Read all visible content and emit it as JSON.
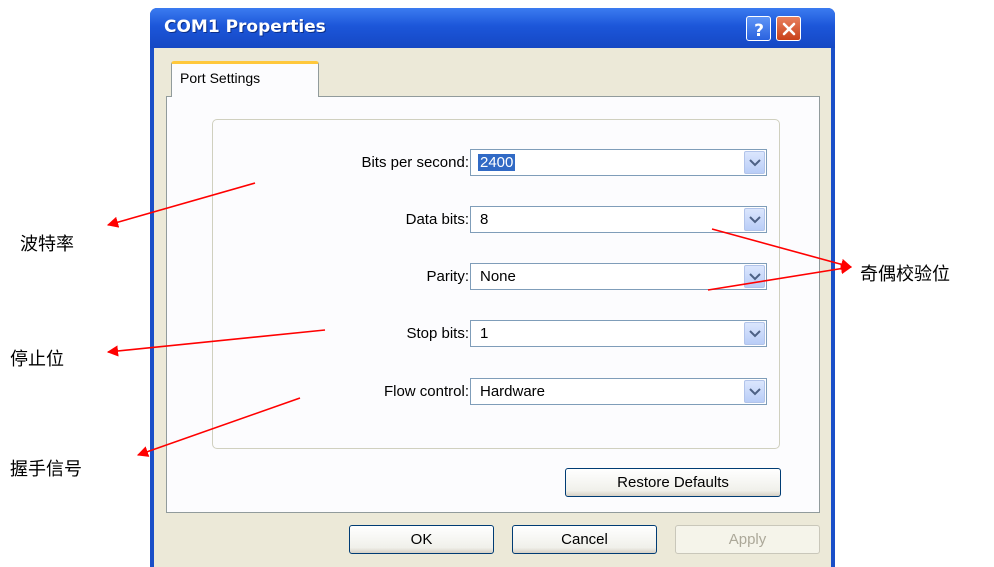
{
  "window": {
    "title": "COM1 Properties",
    "help_button": "?",
    "close_button": "close"
  },
  "tabs": [
    {
      "label": "Port Settings"
    }
  ],
  "fields": [
    {
      "label": "Bits per second:",
      "value": "2400"
    },
    {
      "label": "Data bits:",
      "value": "8"
    },
    {
      "label": "Parity:",
      "value": "None"
    },
    {
      "label": "Stop bits:",
      "value": "1"
    },
    {
      "label": "Flow control:",
      "value": "Hardware"
    }
  ],
  "buttons": {
    "restore": "Restore Defaults",
    "ok": "OK",
    "cancel": "Cancel",
    "apply": "Apply"
  },
  "annotations": {
    "baud": "波特率",
    "parity_bits": "奇偶校验位",
    "stop_bits": "停止位",
    "handshake": "握手信号"
  },
  "colors": {
    "titlebar": "#1c56d9",
    "arrow": "#ff0000",
    "selection": "#316ac5"
  }
}
